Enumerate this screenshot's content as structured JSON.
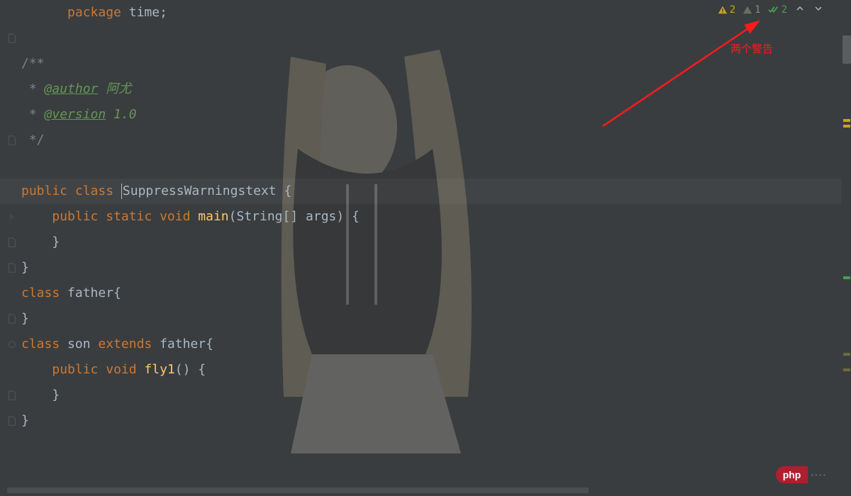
{
  "inspection": {
    "warning_count": "2",
    "weak_warning_count": "1",
    "ok_count": "2"
  },
  "annotation": {
    "text": "两个警告"
  },
  "logo": {
    "pill": "php",
    "tail": "····"
  },
  "code": {
    "l1_kw": "package",
    "l1_pkg": " time",
    "l1_semi": ";",
    "l3_open": "/**",
    "l4_star": " * ",
    "l4_tag": "@author",
    "l4_val": " 阿尤",
    "l5_star": " * ",
    "l5_tag": "@version",
    "l5_val": " 1.0",
    "l6_close": " */",
    "l8_pub": "public",
    "l8_class": " class ",
    "l8_name": "SuppressWarningstext",
    "l8_brace": " {",
    "l9_indent": "    ",
    "l9_pub": "public",
    "l9_static": " static",
    "l9_void": " void",
    "l9_main": " main",
    "l9_paren": "(",
    "l9_str": "String",
    "l9_arr": "[] ",
    "l9_args": "args",
    "l9_close": ") {",
    "l10_indent": "    ",
    "l10_brace": "}",
    "l11_brace": "}",
    "l12_class": "class",
    "l12_name": " father",
    "l12_brace": "{",
    "l13_brace": "}",
    "l14_class": "class",
    "l14_name": " son",
    "l14_ext": " extends",
    "l14_parent": " father",
    "l14_brace": "{",
    "l15_indent": "    ",
    "l15_pub": "public",
    "l15_void": " void",
    "l15_fly": " fly1",
    "l15_paren": "() {",
    "l16_indent": "    ",
    "l16_brace": "}",
    "l17_brace": "}"
  }
}
